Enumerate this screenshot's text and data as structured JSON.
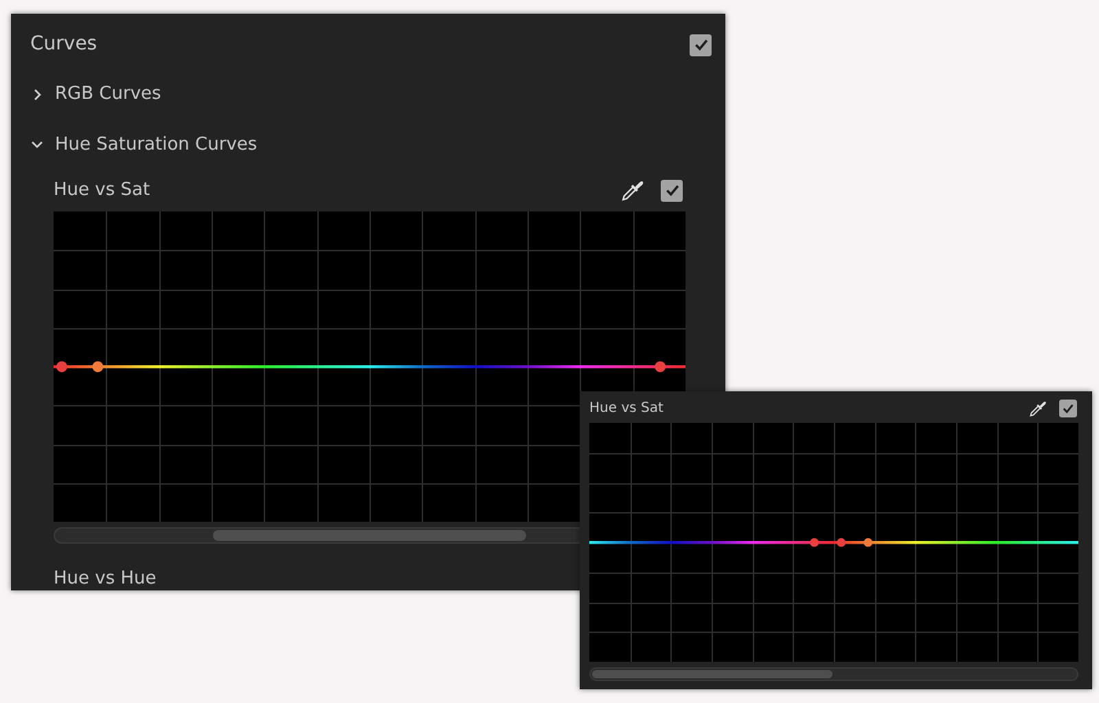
{
  "panels": [
    {
      "title": "Curves",
      "enabled": true,
      "sections": [
        {
          "label": "RGB Curves",
          "expanded": false
        },
        {
          "label": "Hue Saturation Curves",
          "expanded": true
        }
      ],
      "curve": {
        "label": "Hue vs Sat",
        "enabled": true,
        "kind": "full",
        "points": [
          {
            "color": "#e8403f",
            "level": 0.013
          },
          {
            "color": "#f07a3a",
            "level": 0.07
          },
          {
            "color": "#e8403f",
            "level": 0.96
          }
        ]
      },
      "next_label": "Hue vs Hue"
    },
    {
      "title": "Hue vs Sat",
      "enabled": true,
      "curve": {
        "kind": "red-centered",
        "points": [
          {
            "color": "#e8403f",
            "level": 0.46
          },
          {
            "color": "#e8403f",
            "level": 0.515
          },
          {
            "color": "#f07a3a",
            "level": 0.57
          }
        ]
      }
    }
  ]
}
